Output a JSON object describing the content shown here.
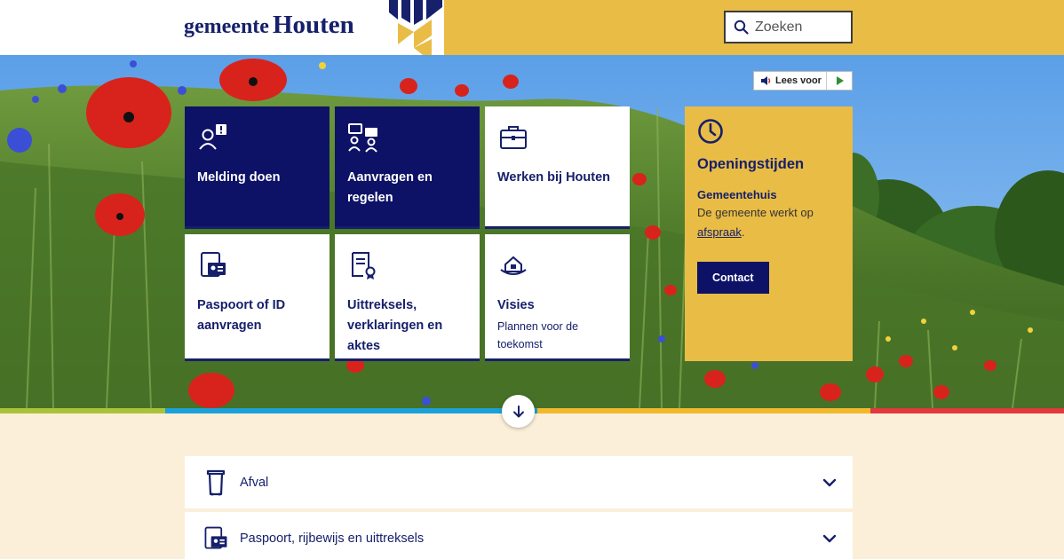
{
  "header": {
    "logo_prefix": "gemeente",
    "logo_name": "Houten",
    "search_placeholder": "Zoeken"
  },
  "readspeaker": {
    "label": "Lees voor"
  },
  "tiles": [
    {
      "label": "Melding doen",
      "icon": "report-person-icon",
      "style": "dark"
    },
    {
      "label": "Aanvragen en regelen",
      "icon": "conversation-icon",
      "style": "dark"
    },
    {
      "label": "Werken bij Houten",
      "icon": "briefcase-icon",
      "style": "light"
    },
    {
      "label": "Paspoort of ID aanvragen",
      "icon": "id-card-icon",
      "style": "light"
    },
    {
      "label": "Uittreksels, verklaringen en aktes",
      "icon": "certificate-icon",
      "style": "light"
    },
    {
      "label": "Visies",
      "sub": "Plannen voor de toekomst",
      "icon": "house-vision-icon",
      "style": "light"
    }
  ],
  "hours": {
    "title": "Openingstijden",
    "subtitle": "Gemeentehuis",
    "text": "De gemeente werkt op",
    "link": "afspraak",
    "link_suffix": ".",
    "button": "Contact"
  },
  "accordion": [
    {
      "label": "Afval",
      "icon": "waste-bin-icon"
    },
    {
      "label": "Paspoort, rijbewijs en uittreksels",
      "icon": "id-card-icon"
    }
  ],
  "colors": {
    "navy": "#0d1266",
    "yellow": "#e9bc45",
    "bar": [
      "#a9c23a",
      "#1ba1d8",
      "#f1b82d",
      "#e0393e"
    ]
  }
}
